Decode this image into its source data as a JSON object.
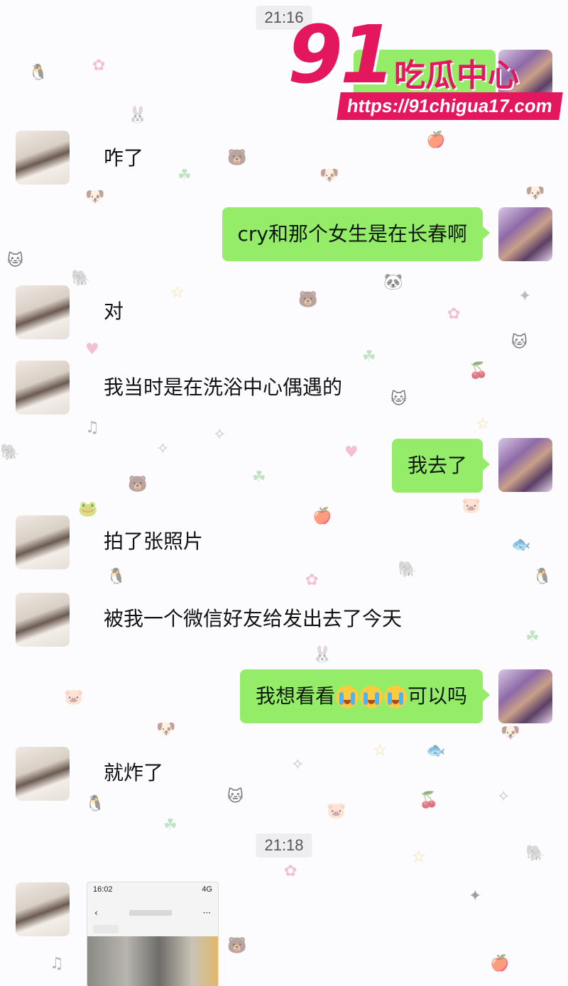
{
  "chat": {
    "timestamps": [
      "21:16",
      "21:18"
    ],
    "messages": [
      {
        "side": "in",
        "text": "咋了"
      },
      {
        "side": "out",
        "text": "cry和那个女生是在长春啊"
      },
      {
        "side": "in",
        "text": "对"
      },
      {
        "side": "in",
        "text": "我当时是在洗浴中心偶遇的"
      },
      {
        "side": "out",
        "text": "我去了"
      },
      {
        "side": "in",
        "text": "拍了张照片"
      },
      {
        "side": "in",
        "text": "被我一个微信好友给发出去了今天"
      },
      {
        "side": "out",
        "text_before": "我想看看",
        "emoji": "loudly-crying-face x3",
        "text_after": "可以吗"
      },
      {
        "side": "in",
        "text": "就炸了"
      }
    ],
    "photo_message": {
      "status_time": "16:02",
      "status_icons": "4G",
      "nav_back": "‹",
      "nav_more": "···"
    }
  },
  "watermark": {
    "number": "91",
    "brand": "吃瓜中心",
    "url": "https://91chigua17.com",
    "color": "#e4165d"
  },
  "colors": {
    "outgoing_bubble": "#95ec69",
    "background": "#fcfbfd"
  }
}
